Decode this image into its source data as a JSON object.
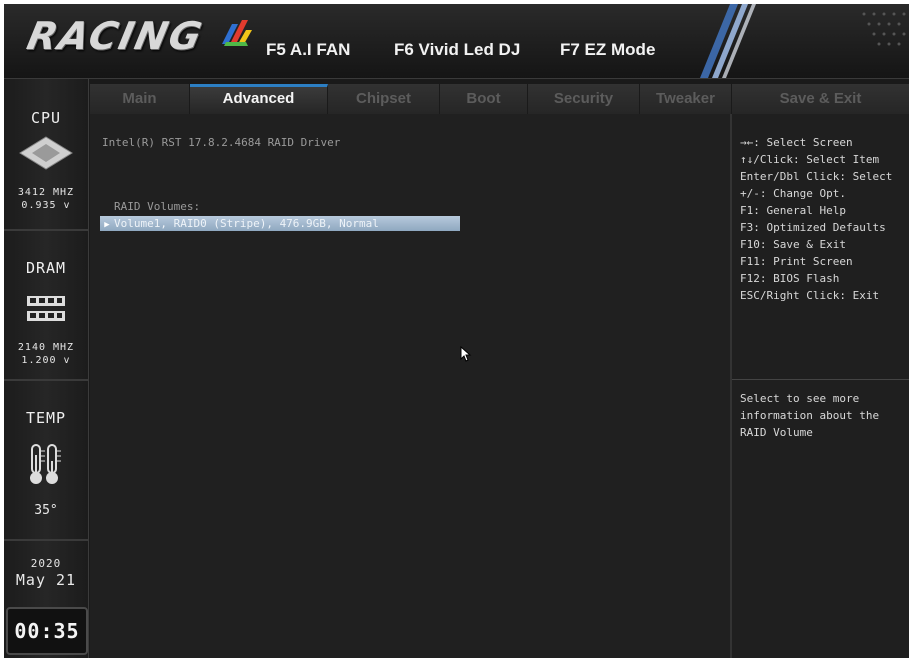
{
  "header": {
    "logo": "RACING",
    "fkeys": [
      "F5 A.I FAN",
      "F6 Vivid Led DJ",
      "F7 EZ Mode"
    ]
  },
  "tabs": [
    {
      "label": "Main",
      "active": false
    },
    {
      "label": "Advanced",
      "active": true
    },
    {
      "label": "Chipset",
      "active": false
    },
    {
      "label": "Boot",
      "active": false
    },
    {
      "label": "Security",
      "active": false
    },
    {
      "label": "Tweaker",
      "active": false
    },
    {
      "label": "Save & Exit",
      "active": false
    }
  ],
  "sidebar": {
    "cpu_label": "CPU",
    "cpu_freq": "3412 MHZ",
    "cpu_volt": "0.935 v",
    "dram_label": "DRAM",
    "dram_freq": "2140 MHZ",
    "dram_volt": "1.200 v",
    "temp_label": "TEMP",
    "temp_value": "35°",
    "year": "2020",
    "date": "May 21",
    "time": "00:35"
  },
  "main": {
    "driver_line": "Intel(R) RST 17.8.2.4684 RAID Driver",
    "raid_header": "RAID Volumes:",
    "raid_item": "Volume1, RAID0 (Stripe), 476.9GB, Normal"
  },
  "help": {
    "keys": [
      "→←: Select Screen",
      "↑↓/Click: Select Item",
      "Enter/Dbl Click: Select",
      "+/-: Change Opt.",
      "F1: General Help",
      "F3: Optimized Defaults",
      "F10: Save & Exit",
      "F11: Print Screen",
      "F12: BIOS Flash",
      "ESC/Right Click: Exit"
    ],
    "description": [
      "Select to see more",
      "information about the",
      "RAID Volume"
    ]
  },
  "colors": {
    "accent_blue": "#2c7fc4",
    "selection": "#a3b8cf"
  }
}
